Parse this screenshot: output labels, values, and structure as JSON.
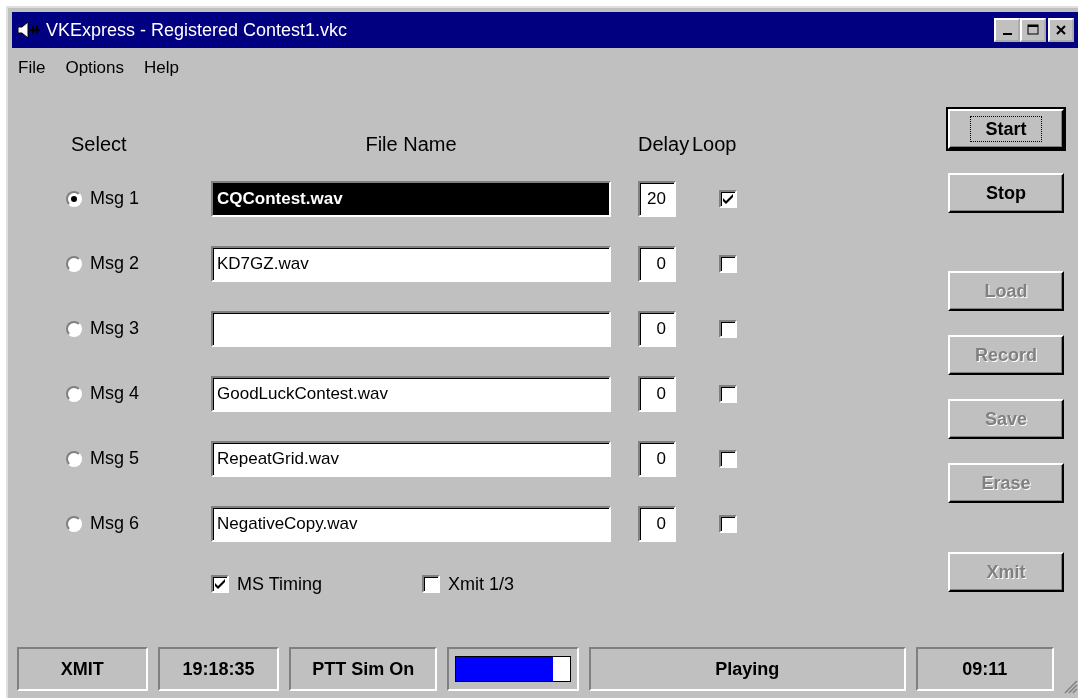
{
  "window": {
    "title": "VKExpress - Registered Contest1.vkc"
  },
  "menu": [
    "File",
    "Options",
    "Help"
  ],
  "headers": {
    "select": "Select",
    "file_name": "File Name",
    "delay": "Delay",
    "loop": "Loop"
  },
  "messages": [
    {
      "label": "Msg 1",
      "selected": true,
      "file": "CQContest.wav",
      "file_highlighted": true,
      "delay": "20",
      "loop": true
    },
    {
      "label": "Msg 2",
      "selected": false,
      "file": "KD7GZ.wav",
      "file_highlighted": false,
      "delay": "0",
      "loop": false
    },
    {
      "label": "Msg 3",
      "selected": false,
      "file_highlighted": false,
      "delay": "0",
      "loop": false
    },
    {
      "label": "Msg 4",
      "selected": false,
      "file": "GoodLuckContest.wav",
      "file_highlighted": false,
      "delay": "0",
      "loop": false
    },
    {
      "label": "Msg 5",
      "selected": false,
      "file": "RepeatGrid.wav",
      "file_highlighted": false,
      "delay": "0",
      "loop": false
    },
    {
      "label": "Msg 6",
      "selected": false,
      "file": "NegativeCopy.wav",
      "file_highlighted": false,
      "delay": "0",
      "loop": false
    }
  ],
  "options": [
    {
      "label": "MS Timing",
      "checked": true
    },
    {
      "label": "Xmit 1/3",
      "checked": false
    }
  ],
  "button_groups": [
    [
      {
        "label": "Start",
        "disabled": false,
        "default": true
      },
      {
        "label": "Stop",
        "disabled": false,
        "default": false
      }
    ],
    [
      {
        "label": "Load",
        "disabled": true,
        "default": false
      },
      {
        "label": "Record",
        "disabled": true,
        "default": false
      },
      {
        "label": "Save",
        "disabled": true,
        "default": false
      },
      {
        "label": "Erase",
        "disabled": true,
        "default": false
      }
    ],
    [
      {
        "label": "Xmit",
        "disabled": true,
        "default": false
      }
    ]
  ],
  "status_bar": [
    {
      "kind": "text",
      "text": "XMIT"
    },
    {
      "kind": "text",
      "text": "19:18:35"
    },
    {
      "kind": "text",
      "text": "PTT Sim On"
    },
    {
      "kind": "meter",
      "level": 0.85
    },
    {
      "kind": "text",
      "text": "Playing"
    },
    {
      "kind": "text",
      "text": "09:11"
    }
  ]
}
